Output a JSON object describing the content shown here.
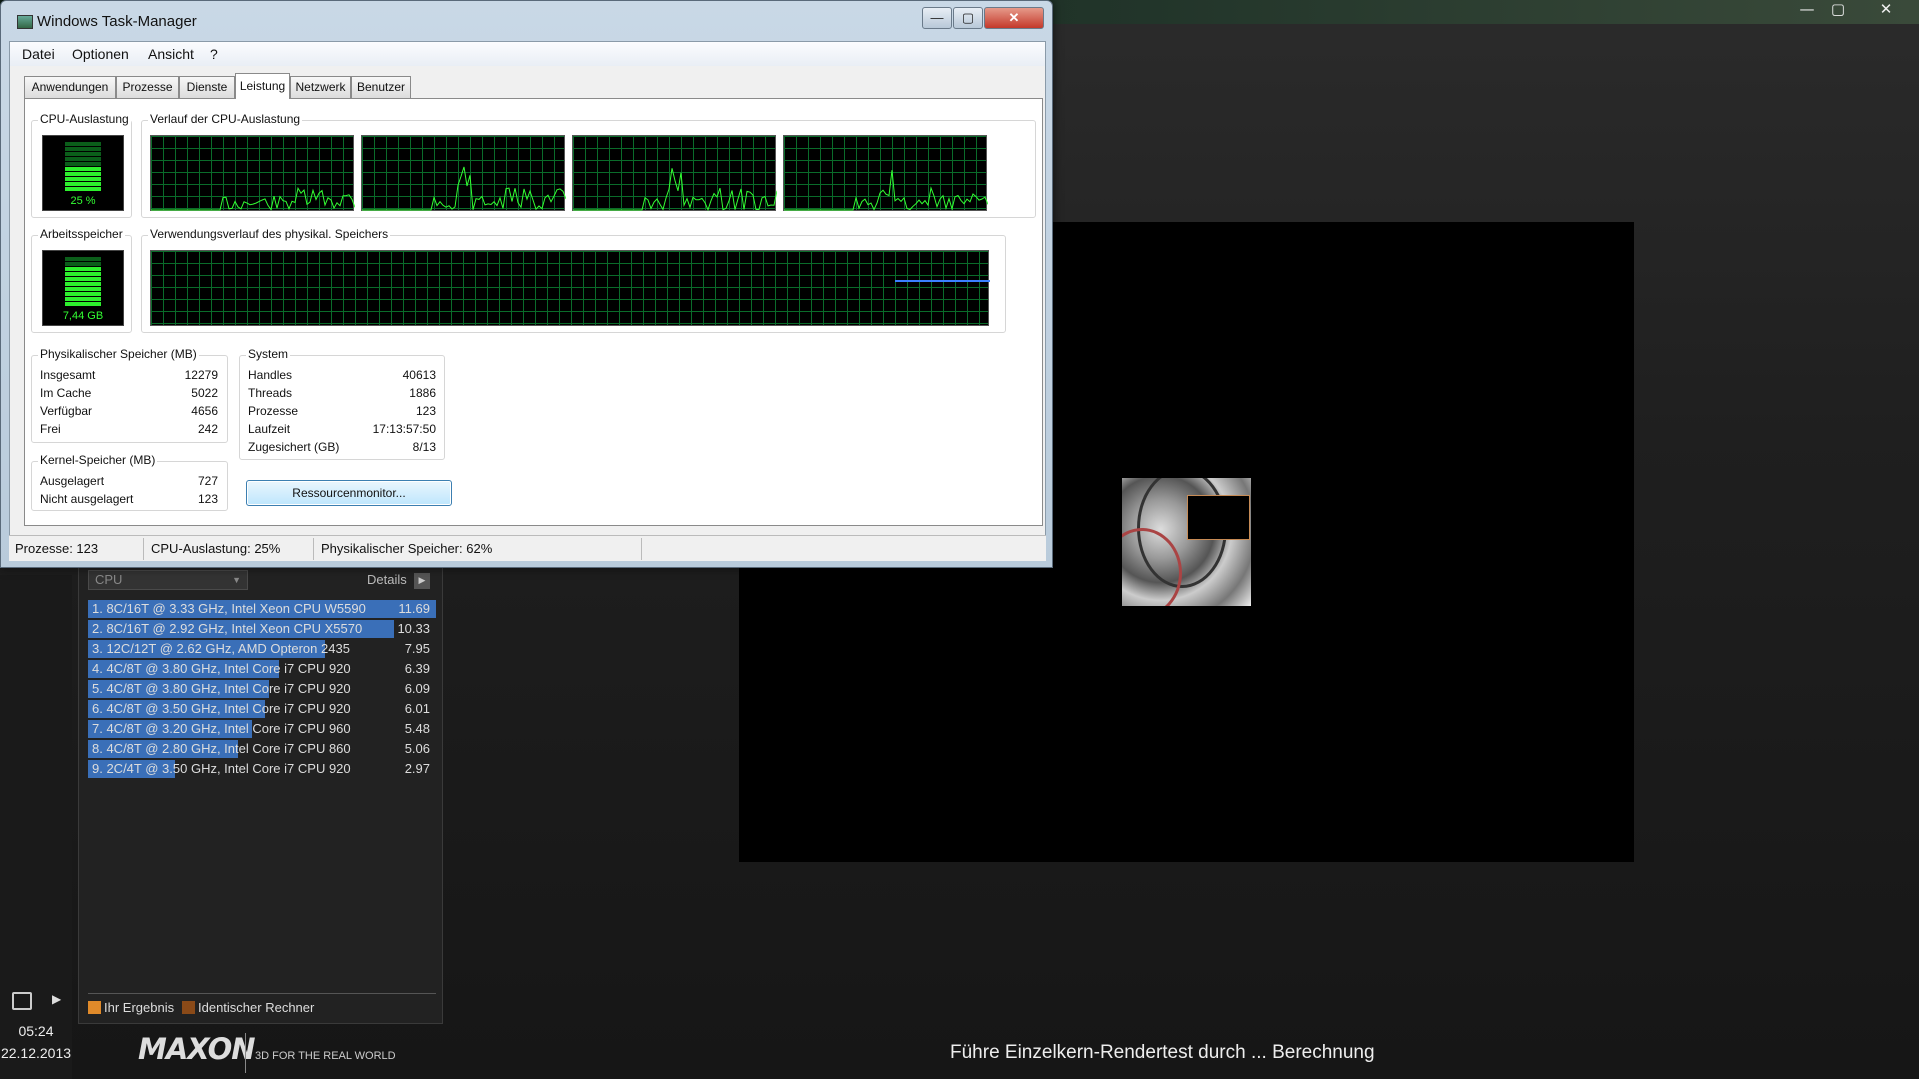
{
  "cinebench": {
    "title_controls": {
      "minimize": "—",
      "maximize": "▢",
      "close": "✕"
    },
    "ranking": {
      "dropdown": "CPU",
      "details_label": "Details",
      "rows": [
        {
          "label": "1. 8C/16T @ 3.33 GHz, Intel Xeon CPU W5590",
          "score": "11.69",
          "fill": 1.0
        },
        {
          "label": "2. 8C/16T @ 2.92 GHz, Intel Xeon CPU X5570",
          "score": "10.33",
          "fill": 0.88
        },
        {
          "label": "3. 12C/12T @ 2.62 GHz, AMD Opteron 2435",
          "score": "7.95",
          "fill": 0.68
        },
        {
          "label": "4. 4C/8T @ 3.80 GHz, Intel Core i7 CPU 920",
          "score": "6.39",
          "fill": 0.55
        },
        {
          "label": "5. 4C/8T @ 3.80 GHz, Intel Core i7 CPU 920",
          "score": "6.09",
          "fill": 0.52
        },
        {
          "label": "6. 4C/8T @ 3.50 GHz, Intel Core i7 CPU 920",
          "score": "6.01",
          "fill": 0.51
        },
        {
          "label": "7. 4C/8T @ 3.20 GHz, Intel Core i7 CPU 960",
          "score": "5.48",
          "fill": 0.47
        },
        {
          "label": "8. 4C/8T @ 2.80 GHz, Intel Core i7 CPU 860",
          "score": "5.06",
          "fill": 0.43
        },
        {
          "label": "9. 2C/4T @ 3.50 GHz, Intel Core i7 CPU 920",
          "score": "2.97",
          "fill": 0.25
        }
      ],
      "legend": {
        "yours": "Ihr Ergebnis",
        "identical": "Identischer Rechner"
      }
    },
    "brand": "MAXON",
    "tagline": "3D FOR THE REAL WORLD",
    "status": "Führe Einzelkern-Rendertest durch ... Berechnung",
    "clock": {
      "time": "05:24",
      "date": "22.12.2013"
    }
  },
  "taskmanager": {
    "title": "Windows Task-Manager",
    "menu": [
      "Datei",
      "Optionen",
      "Ansicht",
      "?"
    ],
    "tabs": [
      "Anwendungen",
      "Prozesse",
      "Dienste",
      "Leistung",
      "Netzwerk",
      "Benutzer"
    ],
    "active_tab": "Leistung",
    "cpu_usage": {
      "label": "CPU-Auslastung",
      "value": "25 %",
      "level": 0.25
    },
    "cpu_history": {
      "label": "Verlauf der CPU-Auslastung"
    },
    "memory": {
      "label": "Arbeitsspeicher",
      "value": "7,44 GB",
      "level": 0.62
    },
    "memory_history": {
      "label": "Verwendungsverlauf des physikal. Speichers"
    },
    "physical": {
      "label": "Physikalischer Speicher (MB)",
      "rows": [
        {
          "k": "Insgesamt",
          "v": "12279"
        },
        {
          "k": "Im Cache",
          "v": "5022"
        },
        {
          "k": "Verfügbar",
          "v": "4656"
        },
        {
          "k": "Frei",
          "v": "242"
        }
      ]
    },
    "kernel": {
      "label": "Kernel-Speicher (MB)",
      "rows": [
        {
          "k": "Ausgelagert",
          "v": "727"
        },
        {
          "k": "Nicht ausgelagert",
          "v": "123"
        }
      ]
    },
    "system": {
      "label": "System",
      "rows": [
        {
          "k": "Handles",
          "v": "40613"
        },
        {
          "k": "Threads",
          "v": "1886"
        },
        {
          "k": "Prozesse",
          "v": "123"
        },
        {
          "k": "Laufzeit",
          "v": "17:13:57:50"
        },
        {
          "k": "Zugesichert (GB)",
          "v": "8/13"
        }
      ]
    },
    "resource_button": "Ressourcenmonitor...",
    "statusbar": {
      "processes": "Prozesse: 123",
      "cpu": "CPU-Auslastung: 25%",
      "memory": "Physikalischer Speicher: 62%"
    },
    "colors": {
      "graph_line": "#33ff33",
      "graph_grid": "#0a6b2a",
      "mem_line": "#3a7fff"
    }
  }
}
